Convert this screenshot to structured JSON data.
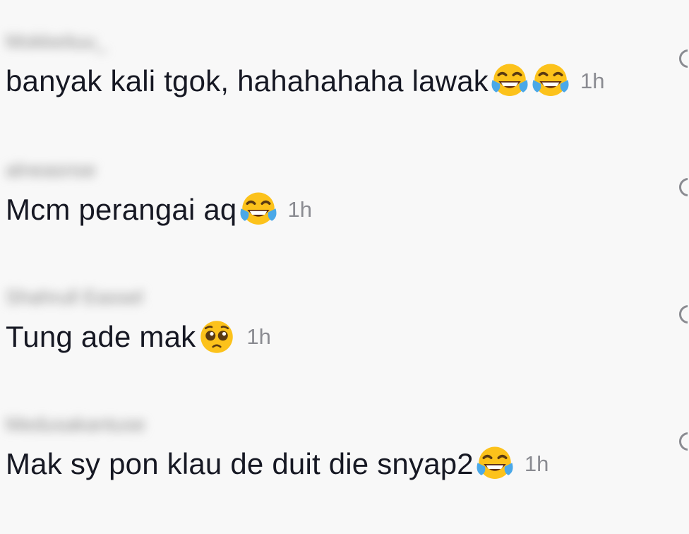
{
  "comments": [
    {
      "username": "Mokkeituu_",
      "text": "banyak kali tgok, hahahahaha lawak ",
      "emojis": [
        "tears-of-joy",
        "tears-of-joy"
      ],
      "time": "1h"
    },
    {
      "username": "alneasnse",
      "text": "Mcm perangai aq",
      "emojis": [
        "tears-of-joy"
      ],
      "time": "1h"
    },
    {
      "username": "Shahrull Eassel",
      "text": "Tung ade mak",
      "emojis": [
        "pleading-face"
      ],
      "time": "1h"
    },
    {
      "username": "Medusakantuse",
      "text": "Mak sy pon klau de duit die snyap2",
      "emojis": [
        "tears-of-joy"
      ],
      "time": "1h"
    }
  ],
  "colors": {
    "background": "#f8f8f8",
    "text": "#161823",
    "muted": "#8a8b91"
  }
}
